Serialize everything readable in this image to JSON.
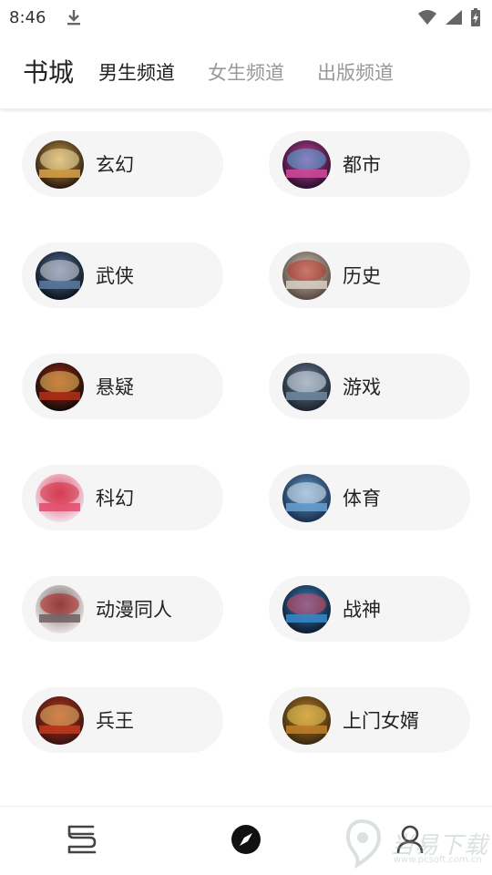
{
  "status_bar": {
    "time": "8:46",
    "icons": [
      "download-icon",
      "wifi-icon",
      "signal-icon",
      "battery-charging-icon"
    ]
  },
  "header": {
    "title": "书城",
    "tabs": [
      {
        "label": "男生频道",
        "active": true
      },
      {
        "label": "女生频道",
        "active": false
      },
      {
        "label": "出版频道",
        "active": false
      }
    ]
  },
  "categories": [
    {
      "label": "玄幻",
      "cover_colors": [
        "#2a1a10",
        "#d6a24a",
        "#f2e6b0"
      ]
    },
    {
      "label": "都市",
      "cover_colors": [
        "#2b1030",
        "#d04a9c",
        "#4fb0e0"
      ]
    },
    {
      "label": "武侠",
      "cover_colors": [
        "#0c1420",
        "#5e7aa0",
        "#d8d8e0"
      ]
    },
    {
      "label": "历史",
      "cover_colors": [
        "#5a4a40",
        "#d8d0c6",
        "#c03020"
      ]
    },
    {
      "label": "悬疑",
      "cover_colors": [
        "#140b08",
        "#b03018",
        "#e8c860"
      ]
    },
    {
      "label": "游戏",
      "cover_colors": [
        "#1c2430",
        "#7088a0",
        "#e0e6ee"
      ]
    },
    {
      "label": "科幻",
      "cover_colors": [
        "#f0dce4",
        "#e04a6a",
        "#d03040"
      ]
    },
    {
      "label": "体育",
      "cover_colors": [
        "#1a3050",
        "#6aa0d0",
        "#e0ecf6"
      ]
    },
    {
      "label": "动漫同人",
      "cover_colors": [
        "#e6e2e0",
        "#706060",
        "#b02020"
      ]
    },
    {
      "label": "战神",
      "cover_colors": [
        "#101c30",
        "#3a88c8",
        "#e04860"
      ]
    },
    {
      "label": "兵王",
      "cover_colors": [
        "#3a1410",
        "#c03a20",
        "#e8c070"
      ]
    },
    {
      "label": "上门女婿",
      "cover_colors": [
        "#3a2a10",
        "#c0802a",
        "#f0d060"
      ]
    }
  ],
  "bottom_nav": [
    {
      "name": "bookshelf-icon",
      "active": false
    },
    {
      "name": "discover-compass-icon",
      "active": true
    },
    {
      "name": "profile-icon",
      "active": false
    }
  ],
  "watermark": {
    "text": "当易下载",
    "sub": "www.pcsoft.com.cn"
  }
}
